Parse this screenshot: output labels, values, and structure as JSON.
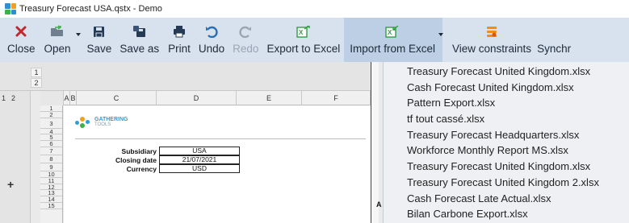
{
  "window": {
    "title": "Treasury Forecast USA.qstx - Demo"
  },
  "toolbar": {
    "buttons": [
      {
        "label": "Close",
        "icon": "close-icon"
      },
      {
        "label": "Open",
        "icon": "folder-open-icon"
      },
      {
        "label": "Save",
        "icon": "save-icon"
      },
      {
        "label": "Save as",
        "icon": "save-as-icon"
      },
      {
        "label": "Print",
        "icon": "printer-icon"
      },
      {
        "label": "Undo",
        "icon": "undo-icon"
      },
      {
        "label": "Redo",
        "icon": "redo-icon"
      },
      {
        "label": "Export to Excel",
        "icon": "excel-export-icon"
      },
      {
        "label": "Import from Excel",
        "icon": "excel-import-icon"
      },
      {
        "label": "View constraints",
        "icon": "constraints-icon"
      },
      {
        "label": "Synchr",
        "icon": ""
      }
    ]
  },
  "sheet": {
    "outline_levels_top": [
      "1",
      "2"
    ],
    "outline_levels_side": [
      "1",
      "2"
    ],
    "outline_expand": "+",
    "columns": [
      "A",
      "B",
      "C",
      "D",
      "E",
      "F"
    ],
    "rows": [
      "1",
      "2",
      "3",
      "4",
      "5",
      "6",
      "7",
      "8",
      "9",
      "10",
      "11",
      "12",
      "13",
      "14",
      "15"
    ],
    "logo": {
      "line1": "GATHERING",
      "line2": "TOOLS"
    },
    "form": [
      {
        "label": "Subsidiary",
        "value": "USA"
      },
      {
        "label": "Closing date",
        "value": "21/07/2021"
      },
      {
        "label": "Currency",
        "value": "USD"
      }
    ],
    "right_label": "A"
  },
  "import_menu": {
    "items": [
      "Treasury Forecast United Kingdom.xlsx",
      "Cash Forecast United Kingdom.xlsx",
      "Pattern Export.xlsx",
      "tf tout cassé.xlsx",
      "Treasury Forecast Headquarters.xlsx",
      "Workforce Monthly Report MS.xlsx",
      "Treasury Forecast United Kingdom.xlsx",
      "Treasury Forecast United Kingdom 2.xlsx",
      "Cash Forecast Late Actual.xlsx",
      "Bilan Carbone Export.xlsx"
    ]
  },
  "colors": {
    "ribbon_bg": "#d7e2ee",
    "ribbon_active": "#bccfe4",
    "close_red": "#c0282c",
    "excel_green": "#2f9e44",
    "menu_bg": "#eef0f3",
    "brand_blue": "#2a9fd6"
  }
}
